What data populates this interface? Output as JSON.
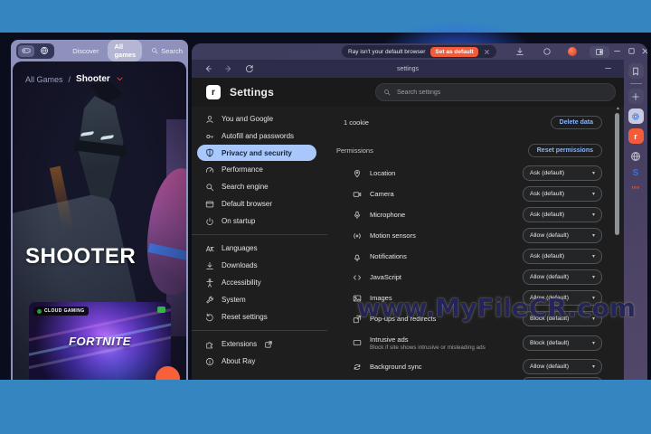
{
  "watermark": "www.MyFileCR.com",
  "colors": {
    "frame_blue": "#3585c0",
    "accent_blue": "#8ab4f8",
    "selected_nav_pill": "#a8c7fa",
    "brand_orange": "#f25c3a"
  },
  "game_window": {
    "toolbar": {
      "discover_label": "Discover",
      "all_games_label": "All games",
      "search_label": "Search"
    },
    "breadcrumb": {
      "root": "All Games",
      "separator": "/",
      "current": "Shooter"
    },
    "category_title": "SHOOTER",
    "game_card": {
      "badge_label": "CLOUD GAMING",
      "game_title": "FORTNITE"
    }
  },
  "browser": {
    "titlebar": {
      "toast_text": "Ray isn't your default browser",
      "set_default_label": "Set as default"
    },
    "nav_bar": {
      "tab_title": "settings"
    },
    "right_sidebar": {
      "s_tab_label": "S",
      "rev_tab_label": "rev"
    },
    "settings": {
      "page_title": "Settings",
      "search_placeholder": "Search settings",
      "nav_items": [
        {
          "label": "You and Google",
          "icon": "person"
        },
        {
          "label": "Autofill and passwords",
          "icon": "key"
        },
        {
          "label": "Privacy and security",
          "icon": "shield",
          "selected": true
        },
        {
          "label": "Performance",
          "icon": "gauge"
        },
        {
          "label": "Search engine",
          "icon": "search"
        },
        {
          "label": "Default browser",
          "icon": "window"
        },
        {
          "label": "On startup",
          "icon": "power"
        },
        {
          "label": "Languages",
          "icon": "translate",
          "divider_before": true
        },
        {
          "label": "Downloads",
          "icon": "download"
        },
        {
          "label": "Accessibility",
          "icon": "accessibility"
        },
        {
          "label": "System",
          "icon": "wrench"
        },
        {
          "label": "Reset settings",
          "icon": "reset"
        },
        {
          "label": "Extensions",
          "icon": "puzzle",
          "external": true,
          "divider_before": true
        },
        {
          "label": "About Ray",
          "icon": "info"
        }
      ],
      "cookies_row": {
        "text": "1 cookie",
        "button_label": "Delete data"
      },
      "permissions": {
        "heading": "Permissions",
        "reset_button_label": "Reset permissions",
        "rows": [
          {
            "label": "Location",
            "icon": "pin",
            "value": "Ask (default)"
          },
          {
            "label": "Camera",
            "icon": "camera",
            "value": "Ask (default)"
          },
          {
            "label": "Microphone",
            "icon": "mic",
            "value": "Ask (default)"
          },
          {
            "label": "Motion sensors",
            "icon": "motion",
            "value": "Allow (default)"
          },
          {
            "label": "Notifications",
            "icon": "bell",
            "value": "Ask (default)"
          },
          {
            "label": "JavaScript",
            "icon": "code",
            "value": "Allow (default)"
          },
          {
            "label": "Images",
            "icon": "image",
            "value": "Allow (default)"
          },
          {
            "label": "Pop-ups and redirects",
            "icon": "popup",
            "value": "Block (default)"
          },
          {
            "label": "Intrusive ads",
            "icon": "ad",
            "sublabel": "Block if site shows intrusive or misleading ads",
            "value": "Block (default)"
          },
          {
            "label": "Background sync",
            "icon": "sync",
            "value": "Allow (default)"
          }
        ]
      }
    }
  }
}
